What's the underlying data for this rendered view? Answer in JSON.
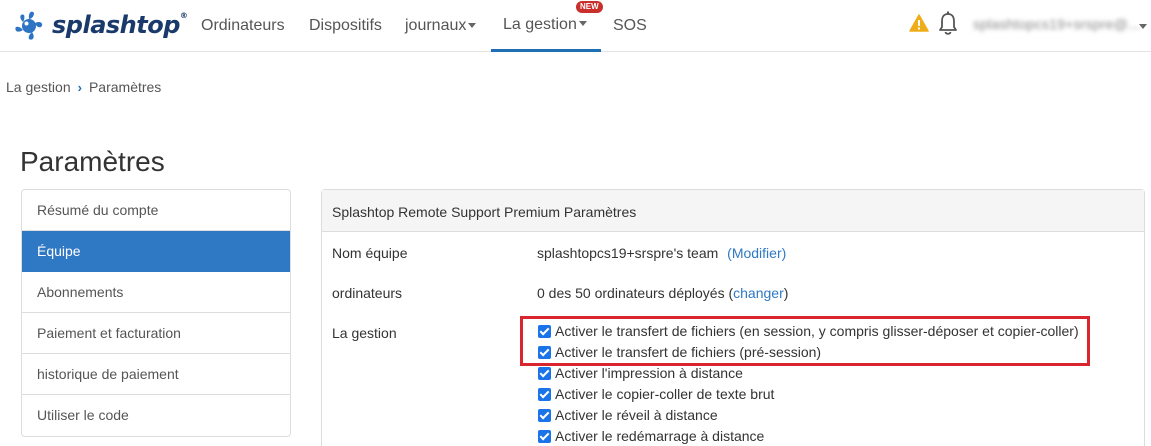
{
  "brand": {
    "name": "splashtop",
    "reg": "®"
  },
  "nav": {
    "items": [
      {
        "label": "Ordinateurs"
      },
      {
        "label": "Dispositifs"
      },
      {
        "label": "journaux"
      },
      {
        "label": "La gestion"
      },
      {
        "label": "SOS"
      }
    ],
    "new_badge": "NEW"
  },
  "user": {
    "email": "splashtopcs19+srspre@..."
  },
  "breadcrumb": {
    "root": "La gestion",
    "current": "Paramètres"
  },
  "page_title": "Paramètres",
  "sidebar": {
    "items": [
      {
        "label": "Résumé du compte"
      },
      {
        "label": "Équipe"
      },
      {
        "label": "Abonnements"
      },
      {
        "label": "Paiement et facturation"
      },
      {
        "label": "historique de paiement"
      },
      {
        "label": "Utiliser le code"
      }
    ],
    "active": "Équipe"
  },
  "panel": {
    "title": "Splashtop Remote Support Premium Paramètres",
    "team_label": "Nom équipe",
    "team_value": "splashtopcs19+srspre's team",
    "team_link": "(Modifier)",
    "computers_label": "ordinateurs",
    "computers_value": "0 des 50 ordinateurs déployés",
    "computers_link_open": "(",
    "computers_link": "changer",
    "computers_link_close": ")",
    "management_label": "La gestion",
    "options": [
      {
        "label": "Activer le transfert de fichiers (en session, y compris glisser-déposer et copier-coller)",
        "checked": true
      },
      {
        "label": "Activer le transfert de fichiers (pré-session)",
        "checked": true
      },
      {
        "label": "Activer l'impression à distance",
        "checked": true
      },
      {
        "label": "Activer le copier-coller de texte brut",
        "checked": true
      },
      {
        "label": "Activer le réveil à distance",
        "checked": true
      },
      {
        "label": "Activer le redémarrage à distance",
        "checked": true
      }
    ]
  },
  "colors": {
    "accent": "#2f78c4",
    "highlight": "#d9252d",
    "brand": "#1a3a6b"
  }
}
